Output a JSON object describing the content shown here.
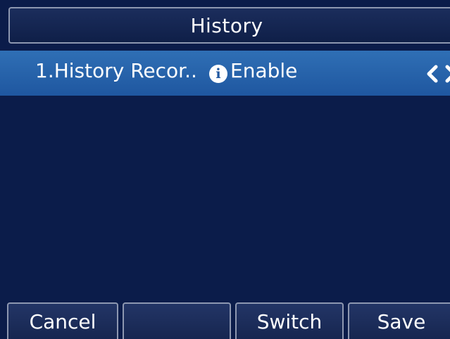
{
  "header": {
    "title": "History"
  },
  "setting_row": {
    "label": "1.History Recor..",
    "info_icon": "info-icon",
    "value": "Enable",
    "prev_icon": "chevron-left-icon",
    "next_icon": "chevron-right-icon"
  },
  "softkeys": {
    "cancel": "Cancel",
    "blank": "",
    "switch": "Switch",
    "save": "Save"
  },
  "colors": {
    "background": "#0b1c4a",
    "selected_row": "#2f6fb5",
    "border": "#8d97b0",
    "text": "#ffffff"
  }
}
